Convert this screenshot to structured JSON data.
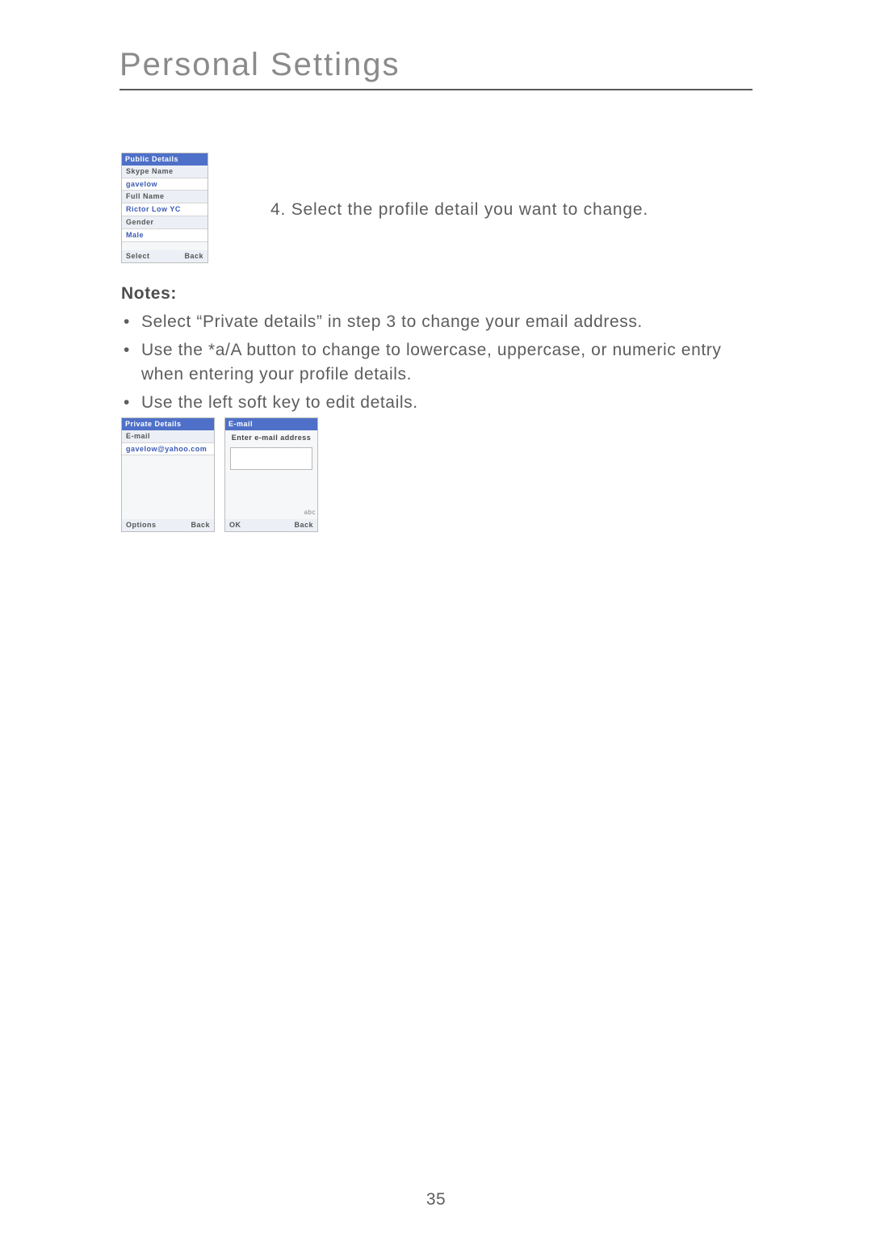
{
  "title": "Personal Settings",
  "step4": "4. Select the profile detail you want to change.",
  "notes_heading": "Notes:",
  "notes": [
    "Select “Private details” in step 3 to change your email address.",
    "Use the *a/A button to change to lowercase, uppercase, or numeric entry when entering your profile details.",
    "Use the left soft key to edit details."
  ],
  "thumb_public": {
    "title": "Public Details",
    "rows": [
      {
        "label": "Skype Name",
        "value": "gavelow"
      },
      {
        "label": "Full Name",
        "value": "Rictor Low YC"
      },
      {
        "label": "Gender",
        "value": "Male"
      }
    ],
    "soft_left": "Select",
    "soft_right": "Back"
  },
  "thumb_private": {
    "title": "Private Details",
    "email_label": "E-mail",
    "email_value": "gavelow@yahoo.com",
    "soft_left": "Options",
    "soft_right": "Back"
  },
  "thumb_email": {
    "title": "E-mail",
    "prompt": "Enter e-mail address",
    "side_hint": "abc",
    "soft_left": "OK",
    "soft_right": "Back"
  },
  "page_number": "35"
}
